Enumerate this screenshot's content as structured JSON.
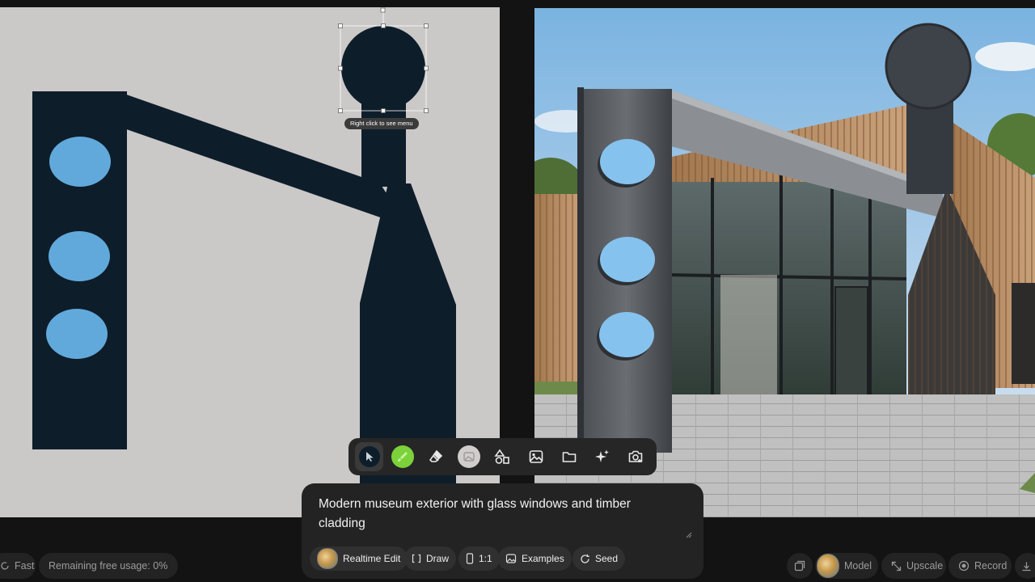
{
  "canvas": {
    "tooltip": "Right click to see menu"
  },
  "toolbar": {
    "tools": [
      {
        "name": "select"
      },
      {
        "name": "brush"
      },
      {
        "name": "eraser"
      },
      {
        "name": "image-fill"
      },
      {
        "name": "shapes"
      },
      {
        "name": "image"
      },
      {
        "name": "folder"
      },
      {
        "name": "sparkle"
      },
      {
        "name": "camera"
      }
    ]
  },
  "prompt": {
    "text": "Modern museum exterior with glass windows and timber cladding"
  },
  "chips": {
    "realtime_edit": "Realtime Edit",
    "draw": "Draw",
    "ratio": "1:1",
    "examples": "Examples",
    "seed": "Seed"
  },
  "bottom_left": {
    "speed": "Fast",
    "usage": "Remaining free usage: 0%"
  },
  "bottom_right": {
    "model": "Model",
    "upscale": "Upscale",
    "record": "Record"
  },
  "colors": {
    "shape_dark": "#0e1d2a",
    "shape_blue": "#62a9db",
    "canvas_bg": "#cbc8c8",
    "brush_green": "#7bd23a"
  }
}
